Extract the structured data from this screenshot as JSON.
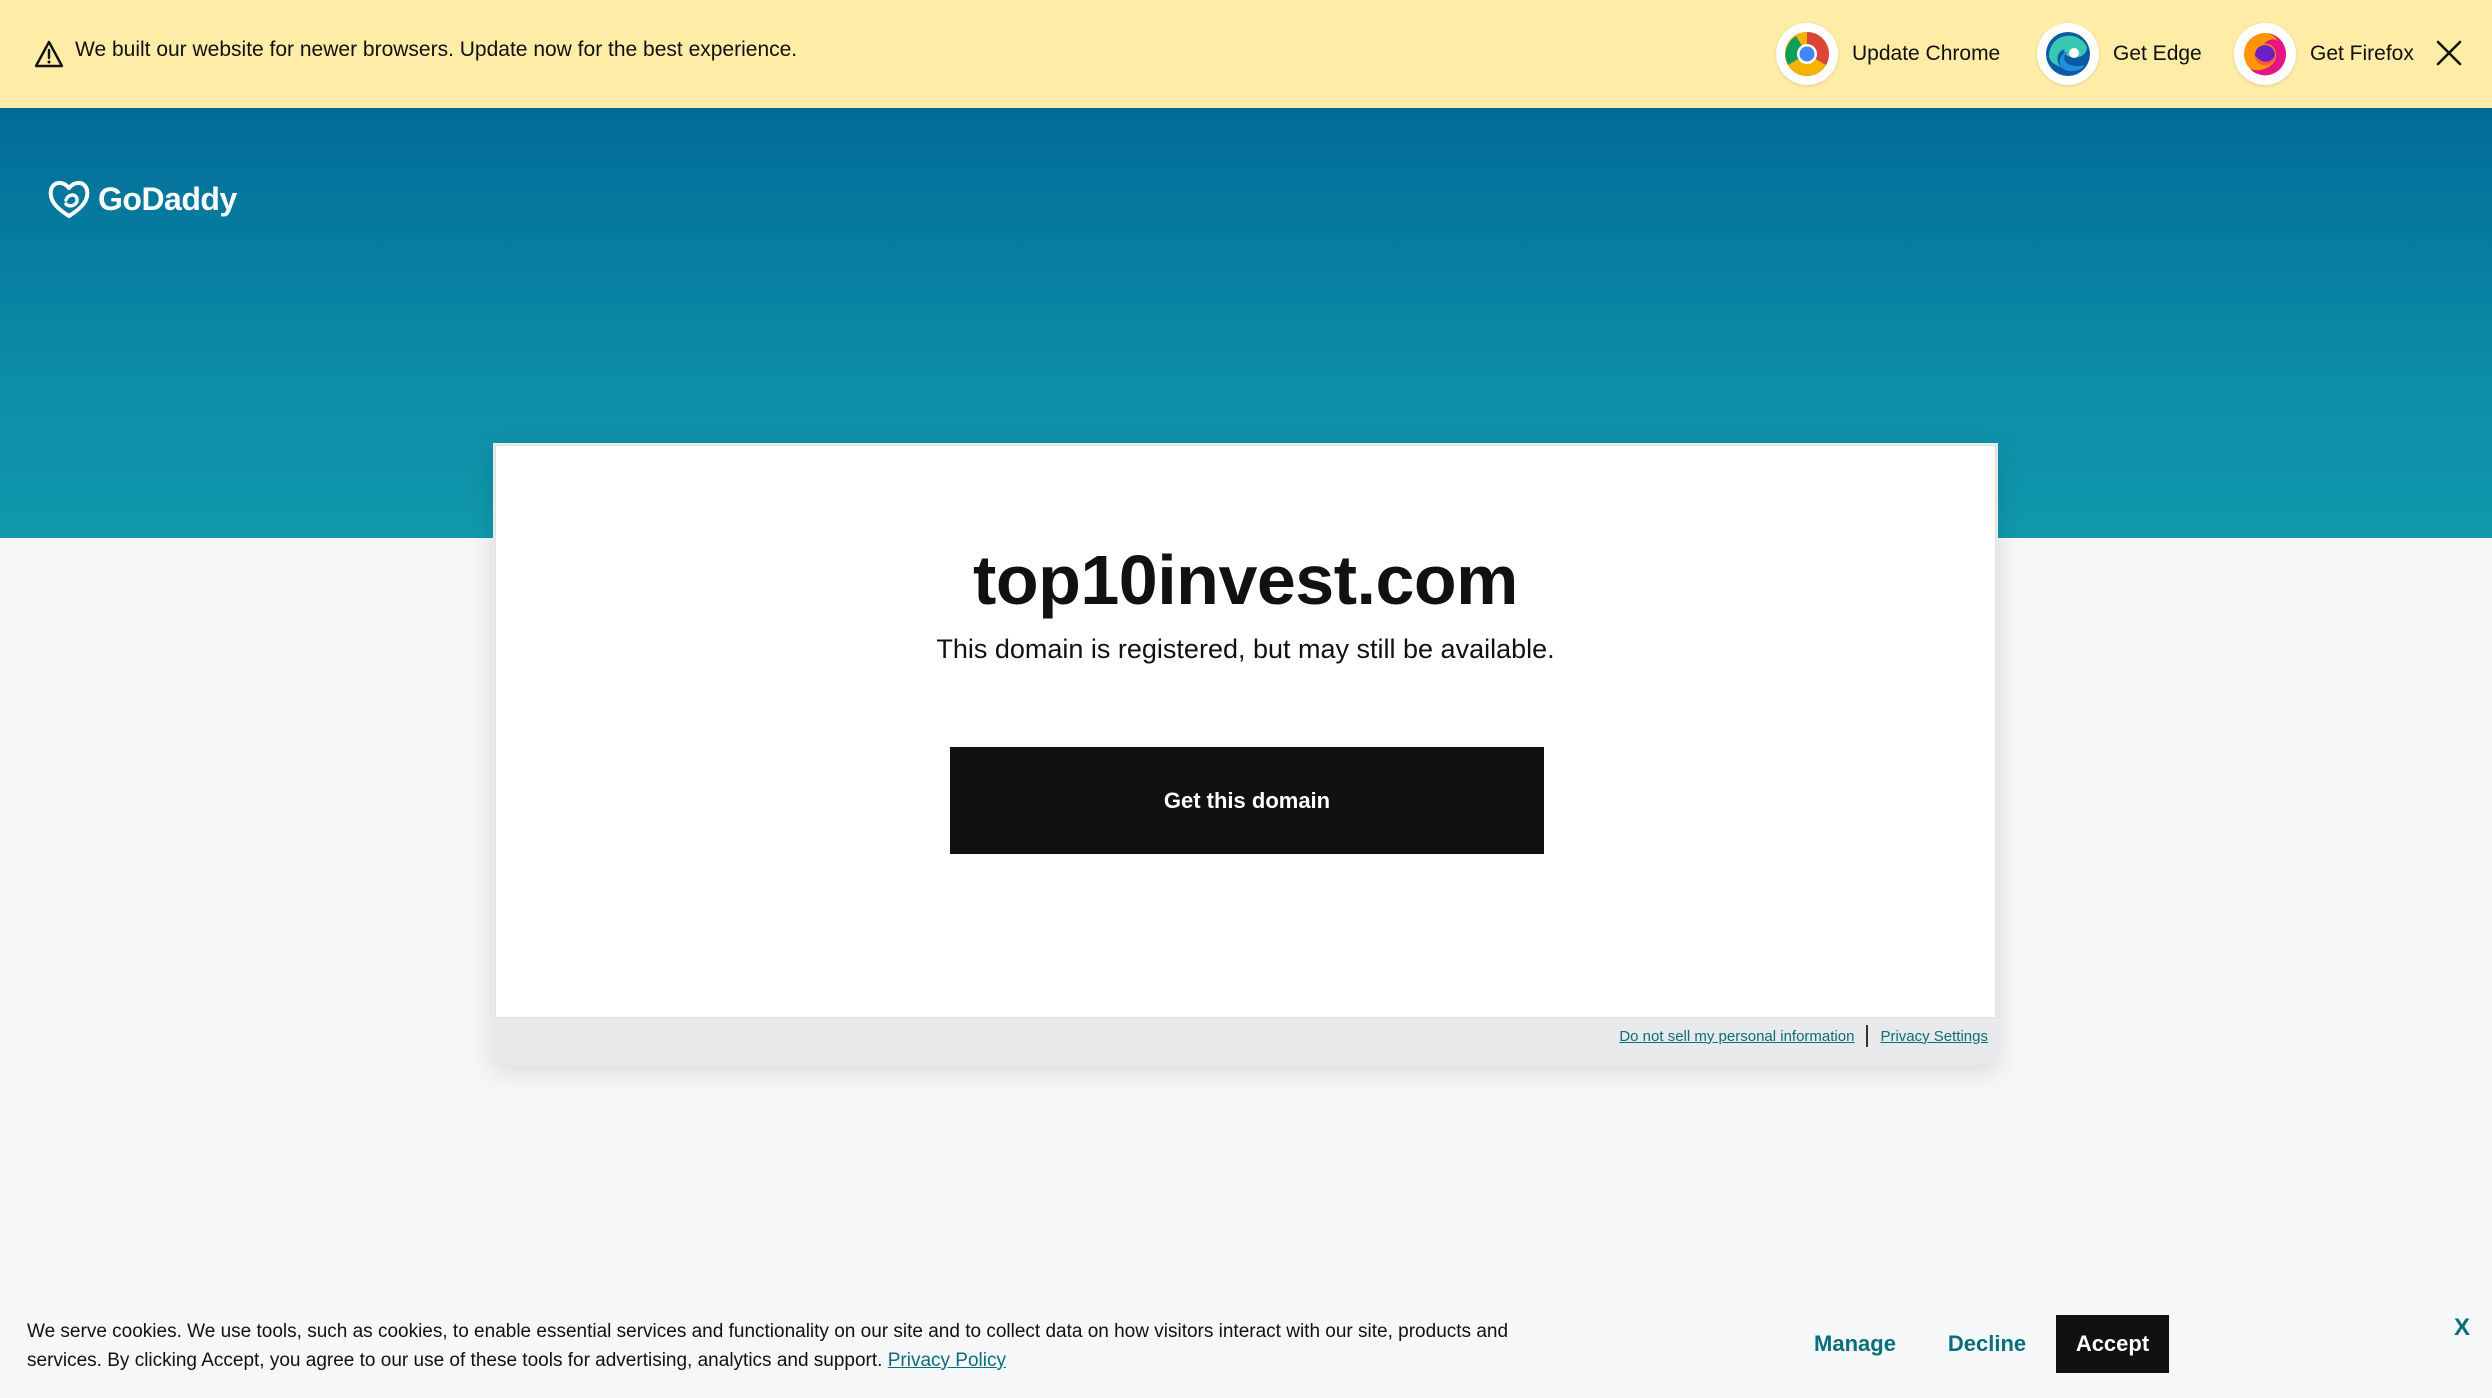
{
  "banner": {
    "message": "We built our website for newer browsers. Update now for the best experience.",
    "warning_icon": "warning-triangle-icon",
    "browsers": [
      {
        "label": "Update Chrome",
        "icon": "chrome-icon"
      },
      {
        "label": "Get Edge",
        "icon": "edge-icon"
      },
      {
        "label": "Get Firefox",
        "icon": "firefox-icon"
      }
    ],
    "close_icon": "close-icon",
    "background": "#feeca7"
  },
  "header": {
    "logo_text": "GoDaddy",
    "gradient": [
      "#026b97",
      "#1199ad"
    ]
  },
  "main": {
    "domain": "top10invest.com",
    "subtitle": "This domain is registered, but may still be available.",
    "cta_label": "Get this domain",
    "legal": {
      "do_not_sell": "Do not sell my personal information",
      "privacy_settings": "Privacy Settings"
    }
  },
  "cookies": {
    "text": "We serve cookies. We use tools, such as cookies, to enable essential services and functionality on our site and to collect data on how visitors interact with our site, products and services. By clicking Accept, you agree to our use of these tools for advertising, analytics and support.",
    "policy_link": "Privacy Policy",
    "manage_label": "Manage",
    "decline_label": "Decline",
    "accept_label": "Accept",
    "close_label": "X",
    "accent": "#0a6e7a"
  }
}
